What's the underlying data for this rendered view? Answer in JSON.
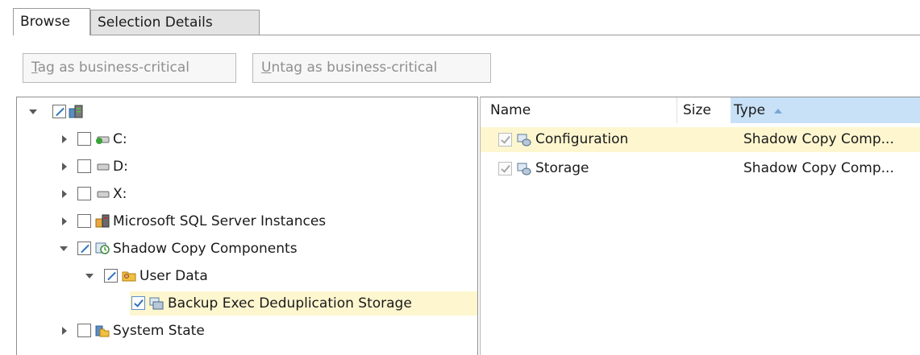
{
  "tabs": {
    "browse": "Browse",
    "selection_details": "Selection Details"
  },
  "toolbar": {
    "tag_prefix": "T",
    "tag_rest": "ag as business-critical",
    "untag_prefix": "U",
    "untag_rest": "ntag as business-critical"
  },
  "tree": {
    "items": [
      {
        "label": "C:"
      },
      {
        "label": "D:"
      },
      {
        "label": "X:"
      },
      {
        "label": "Microsoft SQL Server Instances"
      },
      {
        "label": "Shadow Copy Components"
      },
      {
        "label": "User Data"
      },
      {
        "label": "Backup Exec Deduplication Storage"
      },
      {
        "label": "System State"
      }
    ]
  },
  "list": {
    "columns": {
      "name": "Name",
      "size": "Size",
      "type": "Type"
    },
    "rows": [
      {
        "name": "Configuration",
        "type": "Shadow Copy Comp..."
      },
      {
        "name": "Storage",
        "type": "Shadow Copy Comp..."
      }
    ]
  },
  "colors": {
    "selection": "#fdf6cf",
    "sorted_header": "#c8e1f7",
    "checkbox_accent": "#2b74c2"
  }
}
